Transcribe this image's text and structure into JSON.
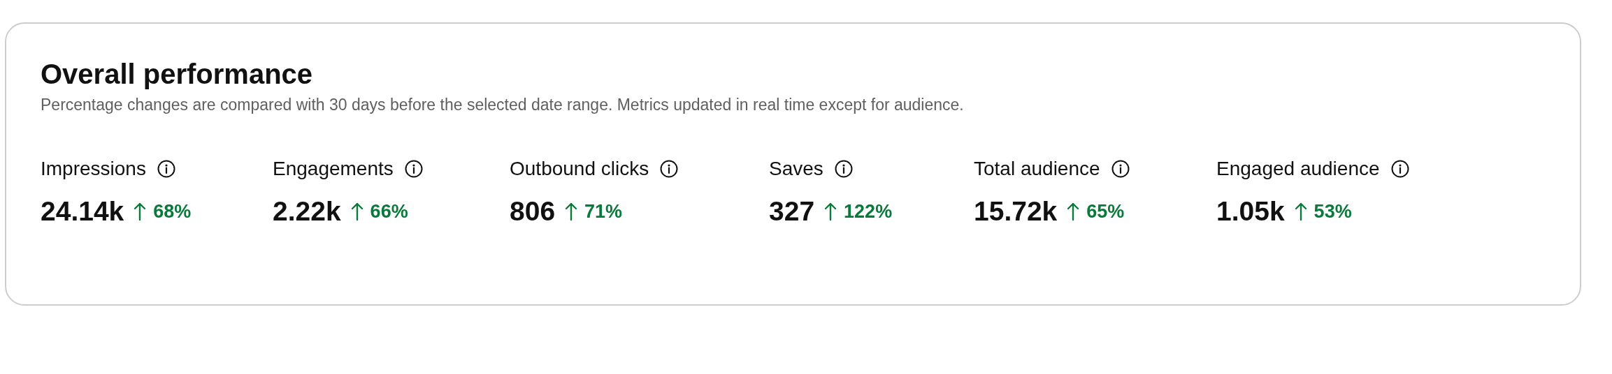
{
  "card": {
    "title": "Overall performance",
    "subtitle": "Percentage changes are compared with 30 days before the selected date range. Metrics updated in real time except for audience.",
    "metrics": [
      {
        "label": "Impressions",
        "value": "24.14k",
        "change": "68%",
        "kind": "up"
      },
      {
        "label": "Engagements",
        "value": "2.22k",
        "change": "66%",
        "kind": "up"
      },
      {
        "label": "Outbound clicks",
        "value": "806",
        "change": "71%",
        "kind": "up"
      },
      {
        "label": "Saves",
        "value": "327",
        "change": "122%",
        "kind": "up"
      },
      {
        "label": "Total audience",
        "value": "15.72k",
        "change": "65%",
        "kind": "up"
      },
      {
        "label": "Engaged audience",
        "value": "1.05k",
        "change": "53%",
        "kind": "up"
      }
    ]
  }
}
